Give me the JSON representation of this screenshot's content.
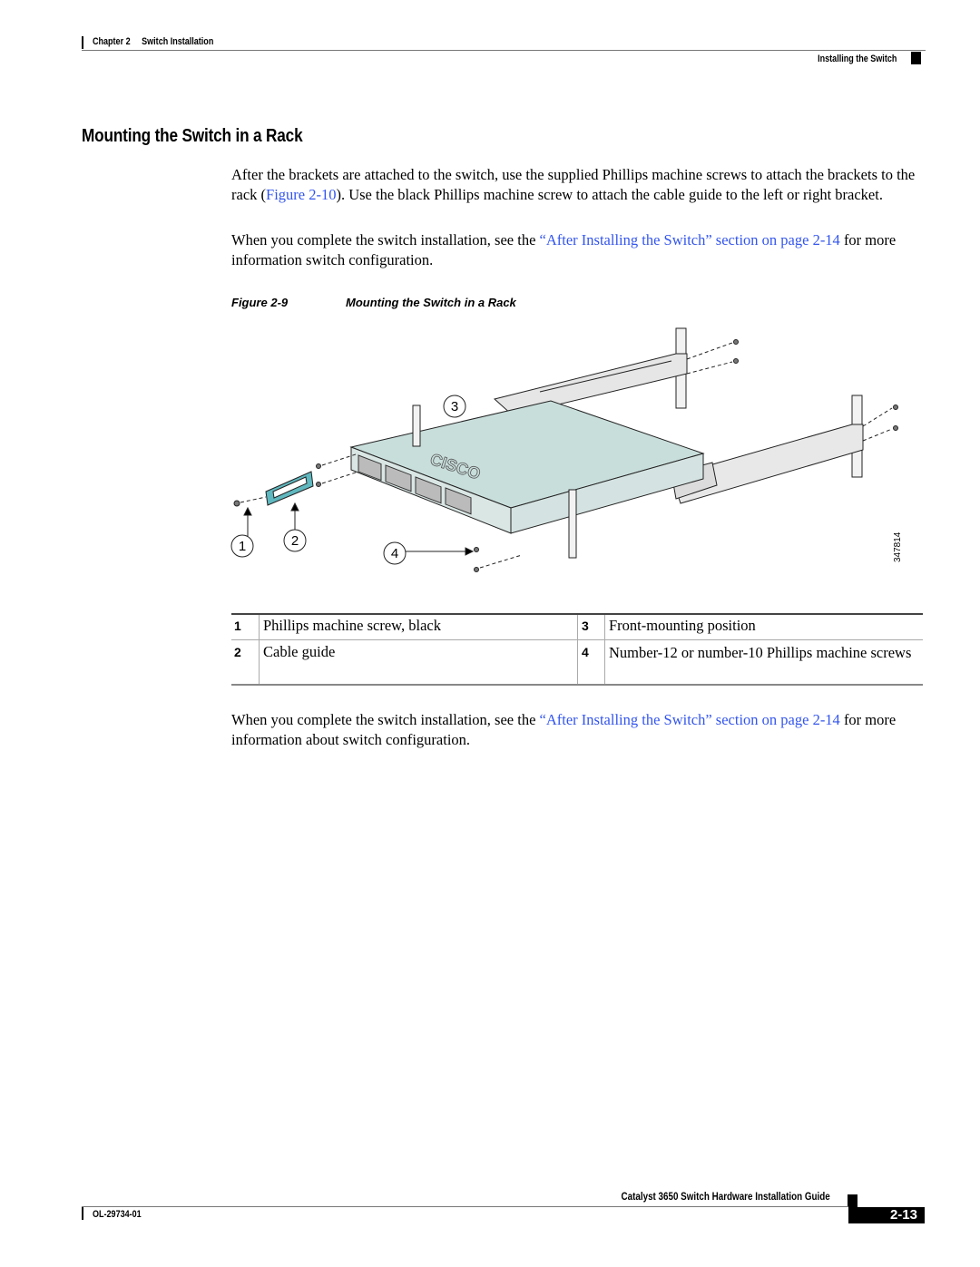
{
  "header": {
    "chapter": "Chapter 2",
    "chapter_title": "Switch Installation",
    "section": "Installing the Switch"
  },
  "heading": "Mounting the Switch in a Rack",
  "paragraph1": {
    "before": "After the brackets are attached to the switch, use the supplied Phillips machine screws to attach the brackets to the rack (",
    "link": "Figure 2-10",
    "after": "). Use the black Phillips machine screw to attach the cable guide to the left or right bracket."
  },
  "paragraph2": {
    "before": "When you complete the switch installation, see the ",
    "link": "“After Installing the Switch” section on page 2-14",
    "after": " for more information switch configuration."
  },
  "figure": {
    "label": "Figure 2-9",
    "title": "Mounting the Switch in a Rack",
    "art_id": "347814",
    "callouts": [
      "1",
      "2",
      "3",
      "4"
    ],
    "logo_text": "CISCO"
  },
  "legend": [
    {
      "num": "1",
      "text": "Phillips machine screw, black"
    },
    {
      "num": "3",
      "text": "Front-mounting position"
    },
    {
      "num": "2",
      "text": "Cable guide"
    },
    {
      "num": "4",
      "text": "Number-12 or number-10 Phillips machine screws"
    }
  ],
  "paragraph3": {
    "before": "When you complete the switch installation, see the ",
    "link": "“After Installing the Switch” section on page 2-14",
    "after": " for more information about switch configuration."
  },
  "footer": {
    "guide_title": "Catalyst 3650 Switch Hardware Installation Guide",
    "doc_number": "OL-29734-01",
    "page_number": "2-13"
  },
  "colors": {
    "link": "#3355ee",
    "switch_body": "#c8dedb",
    "cable_guide": "#5fb8bf"
  }
}
